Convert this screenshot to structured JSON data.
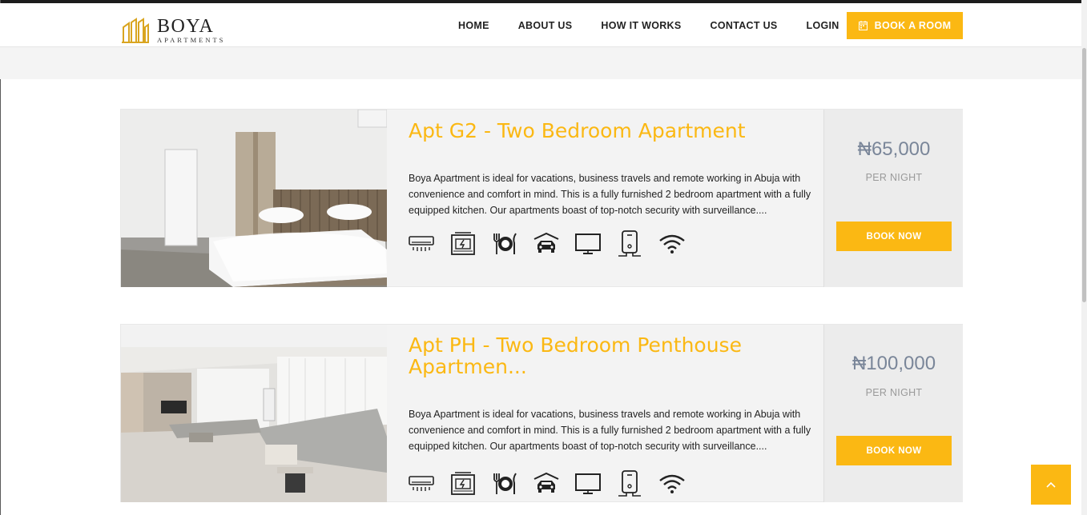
{
  "brand": {
    "name": "BOYA",
    "subtitle": "APARTMENTS"
  },
  "nav": {
    "items": [
      "HOME",
      "ABOUT US",
      "HOW IT WORKS",
      "CONTACT US",
      "LOGIN"
    ]
  },
  "cta": {
    "label": "BOOK A ROOM",
    "icon": "calendar-icon"
  },
  "colors": {
    "accent": "#fbb813",
    "price": "#7a8699",
    "card_bg": "#f3f3f3"
  },
  "listings": [
    {
      "title": "Apt G2 - Two Bedroom Apartment",
      "description": "Boya Apartment is ideal for vacations, business travels and remote working in Abuja with convenience and comfort in mind. This is a fully furnished 2 bedroom apartment with a fully equipped kitchen. Our apartments boast of top-notch security with surveillance....",
      "price": "₦65,000",
      "per": "PER NIGHT",
      "button": "BOOK NOW",
      "amenities": [
        "air-conditioner-icon",
        "generator-icon",
        "dining-icon",
        "parking-icon",
        "tv-icon",
        "water-heater-icon",
        "wifi-icon"
      ]
    },
    {
      "title": "Apt PH - Two Bedroom Penthouse Apartmen...",
      "description": "Boya Apartment is ideal for vacations, business travels and remote working in Abuja with convenience and comfort in mind. This is a fully furnished 2 bedroom apartment with a fully equipped kitchen. Our apartments boast of top-notch security with surveillance....",
      "price": "₦100,000",
      "per": "PER NIGHT",
      "button": "BOOK NOW",
      "amenities": [
        "air-conditioner-icon",
        "generator-icon",
        "dining-icon",
        "parking-icon",
        "tv-icon",
        "water-heater-icon",
        "wifi-icon"
      ]
    }
  ],
  "back_to_top": {
    "icon": "chevron-up-icon"
  }
}
